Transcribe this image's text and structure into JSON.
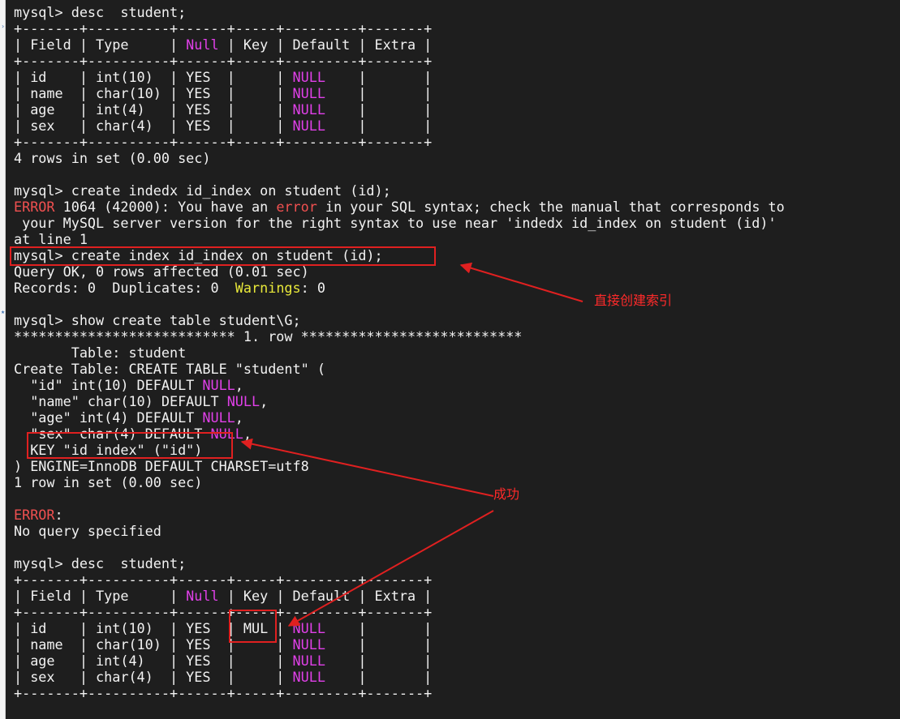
{
  "terminal": {
    "lines": [
      [
        {
          "t": "mysql> desc  student;"
        }
      ],
      [
        {
          "t": "+-------+----------+------+-----+---------+-------+"
        }
      ],
      [
        {
          "t": "| Field | Type     | "
        },
        {
          "t": "Null",
          "c": "null"
        },
        {
          "t": " | Key | Default | Extra |"
        }
      ],
      [
        {
          "t": "+-------+----------+------+-----+---------+-------+"
        }
      ],
      [
        {
          "t": "| id    | int(10)  | YES  |     | "
        },
        {
          "t": "NULL",
          "c": "null"
        },
        {
          "t": "    |       |"
        }
      ],
      [
        {
          "t": "| name  | char(10) | YES  |     | "
        },
        {
          "t": "NULL",
          "c": "null"
        },
        {
          "t": "    |       |"
        }
      ],
      [
        {
          "t": "| age   | int(4)   | YES  |     | "
        },
        {
          "t": "NULL",
          "c": "null"
        },
        {
          "t": "    |       |"
        }
      ],
      [
        {
          "t": "| sex   | char(4)  | YES  |     | "
        },
        {
          "t": "NULL",
          "c": "null"
        },
        {
          "t": "    |       |"
        }
      ],
      [
        {
          "t": "+-------+----------+------+-----+---------+-------+"
        }
      ],
      [
        {
          "t": "4 rows in set (0.00 sec)"
        }
      ],
      [
        {
          "t": ""
        }
      ],
      [
        {
          "t": "mysql> create indedx id_index on student (id);"
        }
      ],
      [
        {
          "t": "ERROR",
          "c": "err"
        },
        {
          "t": " 1064 (42000): You have an "
        },
        {
          "t": "error",
          "c": "err"
        },
        {
          "t": " in your SQL syntax; check the manual that corresponds to"
        }
      ],
      [
        {
          "t": " your MySQL server version for the right syntax to use near 'indedx id_index on student (id)'"
        }
      ],
      [
        {
          "t": "at line 1"
        }
      ],
      [
        {
          "t": "mysql> create index id_index on student (id);"
        }
      ],
      [
        {
          "t": "Query OK, 0 rows affected (0.01 sec)"
        }
      ],
      [
        {
          "t": "Records: 0  Duplicates: 0  "
        },
        {
          "t": "Warnings",
          "c": "warn"
        },
        {
          "t": ": 0"
        }
      ],
      [
        {
          "t": ""
        }
      ],
      [
        {
          "t": "mysql> show create table student\\G;"
        }
      ],
      [
        {
          "t": "*************************** 1. row ***************************"
        }
      ],
      [
        {
          "t": "       Table: student"
        }
      ],
      [
        {
          "t": "Create Table: CREATE TABLE \"student\" ("
        }
      ],
      [
        {
          "t": "  \"id\" int(10) DEFAULT "
        },
        {
          "t": "NULL",
          "c": "null"
        },
        {
          "t": ","
        }
      ],
      [
        {
          "t": "  \"name\" char(10) DEFAULT "
        },
        {
          "t": "NULL",
          "c": "null"
        },
        {
          "t": ","
        }
      ],
      [
        {
          "t": "  \"age\" int(4) DEFAULT "
        },
        {
          "t": "NULL",
          "c": "null"
        },
        {
          "t": ","
        }
      ],
      [
        {
          "t": "  \"sex\" char(4) DEFAULT "
        },
        {
          "t": "NULL",
          "c": "null"
        },
        {
          "t": ","
        }
      ],
      [
        {
          "t": "  KEY \"id_index\" (\"id\")"
        }
      ],
      [
        {
          "t": ") ENGINE=InnoDB DEFAULT CHARSET=utf8"
        }
      ],
      [
        {
          "t": "1 row in set (0.00 sec)"
        }
      ],
      [
        {
          "t": ""
        }
      ],
      [
        {
          "t": "ERROR",
          "c": "err"
        },
        {
          "t": ":"
        }
      ],
      [
        {
          "t": "No query specified"
        }
      ],
      [
        {
          "t": ""
        }
      ],
      [
        {
          "t": "mysql> desc  student;"
        }
      ],
      [
        {
          "t": "+-------+----------+------+-----+---------+-------+"
        }
      ],
      [
        {
          "t": "| Field | Type     | "
        },
        {
          "t": "Null",
          "c": "null"
        },
        {
          "t": " | Key | Default | Extra |"
        }
      ],
      [
        {
          "t": "+-------+----------+------+-----+---------+-------+"
        }
      ],
      [
        {
          "t": "| id    | int(10)  | YES  | MUL | "
        },
        {
          "t": "NULL",
          "c": "null"
        },
        {
          "t": "    |       |"
        }
      ],
      [
        {
          "t": "| name  | char(10) | YES  |     | "
        },
        {
          "t": "NULL",
          "c": "null"
        },
        {
          "t": "    |       |"
        }
      ],
      [
        {
          "t": "| age   | int(4)   | YES  |     | "
        },
        {
          "t": "NULL",
          "c": "null"
        },
        {
          "t": "    |       |"
        }
      ],
      [
        {
          "t": "| sex   | char(4)  | YES  |     | "
        },
        {
          "t": "NULL",
          "c": "null"
        },
        {
          "t": "    |       |"
        }
      ],
      [
        {
          "t": "+-------+----------+------+-----+---------+-------+"
        }
      ]
    ]
  },
  "annotations": {
    "note_create": "直接创建索引",
    "note_success": "成功"
  },
  "colors": {
    "background": "#1e1e1e",
    "text": "#f2f2f2",
    "null_keyword": "#e040e8",
    "warning_keyword": "#e8e83a",
    "error_keyword": "#f05050",
    "annotation_red": "#e02020"
  }
}
